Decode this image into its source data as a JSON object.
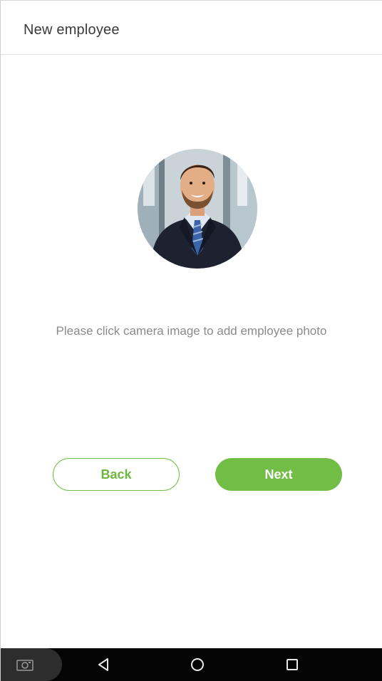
{
  "header": {
    "title": "New employee"
  },
  "photo": {
    "icon": "employee-photo"
  },
  "hint": {
    "text": "Please click camera image to add employee photo"
  },
  "buttons": {
    "back_label": "Back",
    "next_label": "Next"
  },
  "colors": {
    "accent": "#72bd46",
    "hint_text": "#8a8a8a",
    "navbar": "#050505"
  },
  "navbar": {
    "icons": [
      "camera-icon",
      "back-icon",
      "home-icon",
      "recents-icon"
    ]
  }
}
